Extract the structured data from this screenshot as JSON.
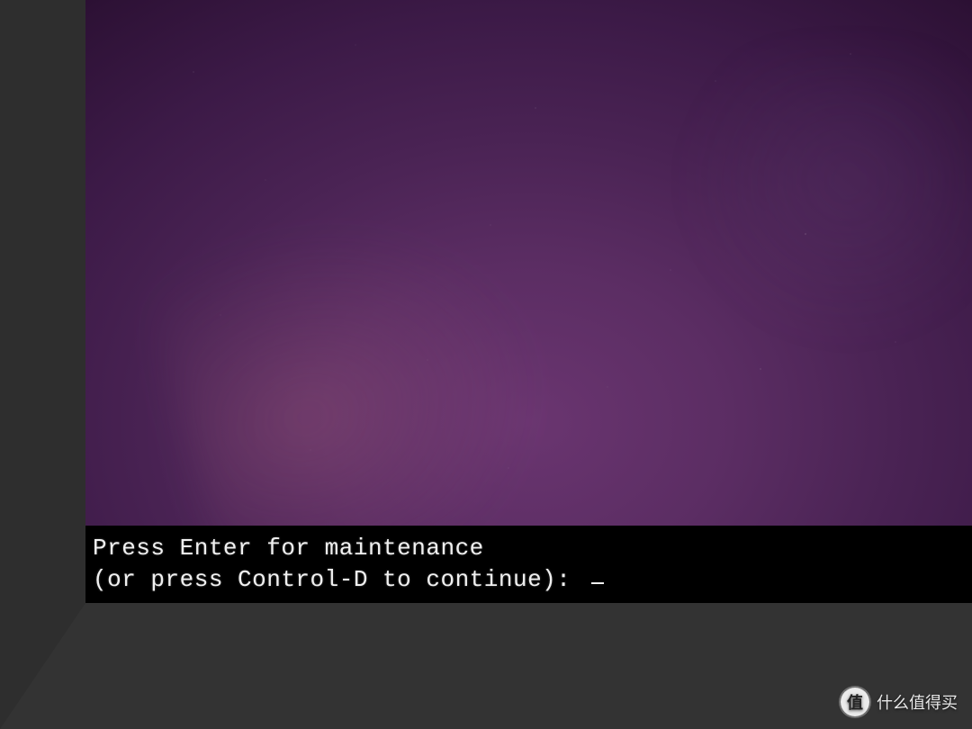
{
  "console": {
    "line1": "Press Enter for maintenance",
    "line2": "(or press Control-D to continue): "
  },
  "watermark": {
    "badge_char": "值",
    "text": "什么值得买"
  }
}
